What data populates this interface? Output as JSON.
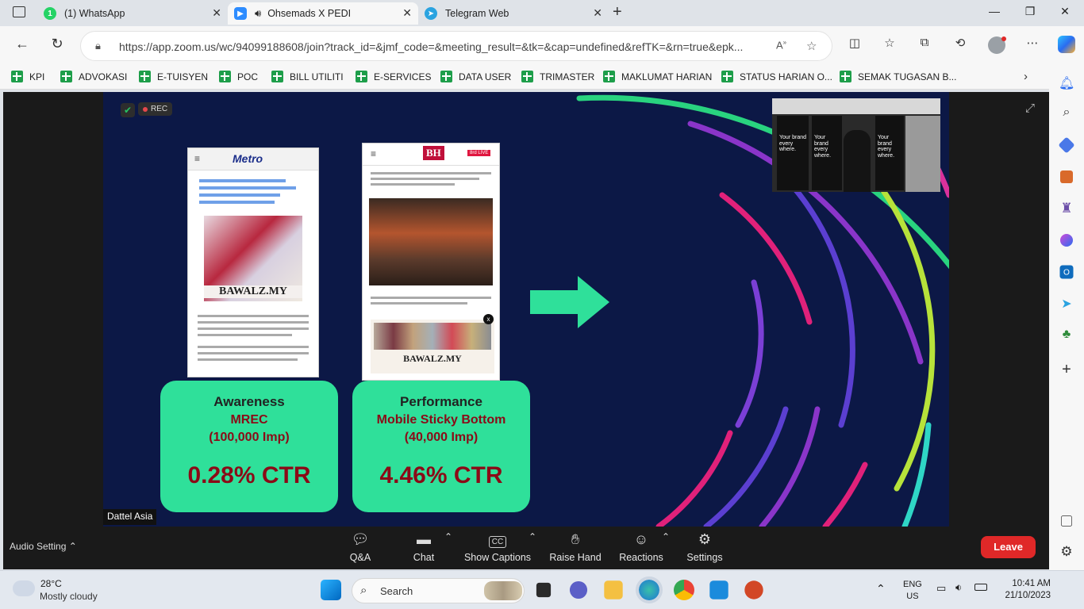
{
  "browser": {
    "tabs": [
      {
        "label": "(1) WhatsApp",
        "icon": "whatsapp-icon",
        "color": "#25d366"
      },
      {
        "label": "Ohsemads X PEDI",
        "icon": "zoom-icon",
        "color": "#2d8cff"
      },
      {
        "label": "Telegram Web",
        "icon": "telegram-icon",
        "color": "#2aa3e0"
      }
    ],
    "url": "https://app.zoom.us/wc/94099188608/join?track_id=&jmf_code=&meeting_result=&tk=&cap=undefined&refTK=&rn=true&epk...",
    "bookmarks": [
      "KPI",
      "ADVOKASI",
      "E-TUISYEN",
      "POC",
      "BILL UTILITI",
      "E-SERVICES",
      "DATA USER",
      "TRIMASTER",
      "MAKLUMAT HARIAN",
      "STATUS HARIAN O...",
      "SEMAK TUGASAN B..."
    ]
  },
  "zoom": {
    "rec_label": "REC",
    "share_label": "Dattel Asia",
    "slide": {
      "phone_left": {
        "brand": "Metro",
        "ad_text": "BAWALZ.MY"
      },
      "phone_right": {
        "brand": "BH",
        "badge": "8rd LIVE",
        "ad_text": "BAWALZ.MY"
      },
      "card_left": {
        "heading": "Awareness",
        "line1": "MREC",
        "line2": "(100,000 Imp)",
        "ctr": "0.28% CTR"
      },
      "card_right": {
        "heading": "Performance",
        "line1": "Mobile Sticky Bottom",
        "line2": "(40,000 Imp)",
        "ctr": "4.46% CTR"
      },
      "camera_text": [
        "Your brand every where.",
        "Your brand every where.",
        "Your brand every where."
      ]
    },
    "controls": [
      {
        "label": "Q&A",
        "icon": "qa-icon"
      },
      {
        "label": "Chat",
        "icon": "chat-icon"
      },
      {
        "label": "Show Captions",
        "icon": "captions-icon",
        "glyph": "CC"
      },
      {
        "label": "Raise Hand",
        "icon": "hand-icon"
      },
      {
        "label": "Reactions",
        "icon": "reactions-icon"
      },
      {
        "label": "Settings",
        "icon": "settings-icon"
      }
    ],
    "audio_setting": "Audio Setting",
    "leave": "Leave"
  },
  "taskbar": {
    "weather_temp": "28°C",
    "weather_desc": "Mostly cloudy",
    "search_placeholder": "Search",
    "lang1": "ENG",
    "lang2": "US",
    "time": "10:41 AM",
    "date": "21/10/2023"
  }
}
